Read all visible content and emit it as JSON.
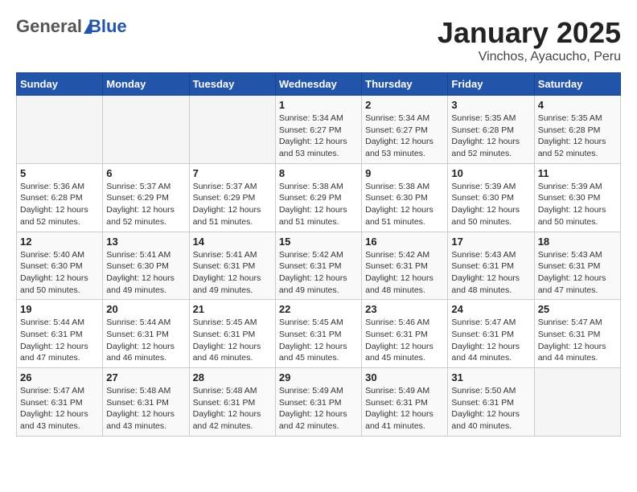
{
  "header": {
    "logo_general": "General",
    "logo_blue": "Blue",
    "title": "January 2025",
    "subtitle": "Vinchos, Ayacucho, Peru"
  },
  "days_of_week": [
    "Sunday",
    "Monday",
    "Tuesday",
    "Wednesday",
    "Thursday",
    "Friday",
    "Saturday"
  ],
  "weeks": [
    [
      {
        "day": "",
        "info": ""
      },
      {
        "day": "",
        "info": ""
      },
      {
        "day": "",
        "info": ""
      },
      {
        "day": "1",
        "info": "Sunrise: 5:34 AM\nSunset: 6:27 PM\nDaylight: 12 hours\nand 53 minutes."
      },
      {
        "day": "2",
        "info": "Sunrise: 5:34 AM\nSunset: 6:27 PM\nDaylight: 12 hours\nand 53 minutes."
      },
      {
        "day": "3",
        "info": "Sunrise: 5:35 AM\nSunset: 6:28 PM\nDaylight: 12 hours\nand 52 minutes."
      },
      {
        "day": "4",
        "info": "Sunrise: 5:35 AM\nSunset: 6:28 PM\nDaylight: 12 hours\nand 52 minutes."
      }
    ],
    [
      {
        "day": "5",
        "info": "Sunrise: 5:36 AM\nSunset: 6:28 PM\nDaylight: 12 hours\nand 52 minutes."
      },
      {
        "day": "6",
        "info": "Sunrise: 5:37 AM\nSunset: 6:29 PM\nDaylight: 12 hours\nand 52 minutes."
      },
      {
        "day": "7",
        "info": "Sunrise: 5:37 AM\nSunset: 6:29 PM\nDaylight: 12 hours\nand 51 minutes."
      },
      {
        "day": "8",
        "info": "Sunrise: 5:38 AM\nSunset: 6:29 PM\nDaylight: 12 hours\nand 51 minutes."
      },
      {
        "day": "9",
        "info": "Sunrise: 5:38 AM\nSunset: 6:30 PM\nDaylight: 12 hours\nand 51 minutes."
      },
      {
        "day": "10",
        "info": "Sunrise: 5:39 AM\nSunset: 6:30 PM\nDaylight: 12 hours\nand 50 minutes."
      },
      {
        "day": "11",
        "info": "Sunrise: 5:39 AM\nSunset: 6:30 PM\nDaylight: 12 hours\nand 50 minutes."
      }
    ],
    [
      {
        "day": "12",
        "info": "Sunrise: 5:40 AM\nSunset: 6:30 PM\nDaylight: 12 hours\nand 50 minutes."
      },
      {
        "day": "13",
        "info": "Sunrise: 5:41 AM\nSunset: 6:30 PM\nDaylight: 12 hours\nand 49 minutes."
      },
      {
        "day": "14",
        "info": "Sunrise: 5:41 AM\nSunset: 6:31 PM\nDaylight: 12 hours\nand 49 minutes."
      },
      {
        "day": "15",
        "info": "Sunrise: 5:42 AM\nSunset: 6:31 PM\nDaylight: 12 hours\nand 49 minutes."
      },
      {
        "day": "16",
        "info": "Sunrise: 5:42 AM\nSunset: 6:31 PM\nDaylight: 12 hours\nand 48 minutes."
      },
      {
        "day": "17",
        "info": "Sunrise: 5:43 AM\nSunset: 6:31 PM\nDaylight: 12 hours\nand 48 minutes."
      },
      {
        "day": "18",
        "info": "Sunrise: 5:43 AM\nSunset: 6:31 PM\nDaylight: 12 hours\nand 47 minutes."
      }
    ],
    [
      {
        "day": "19",
        "info": "Sunrise: 5:44 AM\nSunset: 6:31 PM\nDaylight: 12 hours\nand 47 minutes."
      },
      {
        "day": "20",
        "info": "Sunrise: 5:44 AM\nSunset: 6:31 PM\nDaylight: 12 hours\nand 46 minutes."
      },
      {
        "day": "21",
        "info": "Sunrise: 5:45 AM\nSunset: 6:31 PM\nDaylight: 12 hours\nand 46 minutes."
      },
      {
        "day": "22",
        "info": "Sunrise: 5:45 AM\nSunset: 6:31 PM\nDaylight: 12 hours\nand 45 minutes."
      },
      {
        "day": "23",
        "info": "Sunrise: 5:46 AM\nSunset: 6:31 PM\nDaylight: 12 hours\nand 45 minutes."
      },
      {
        "day": "24",
        "info": "Sunrise: 5:47 AM\nSunset: 6:31 PM\nDaylight: 12 hours\nand 44 minutes."
      },
      {
        "day": "25",
        "info": "Sunrise: 5:47 AM\nSunset: 6:31 PM\nDaylight: 12 hours\nand 44 minutes."
      }
    ],
    [
      {
        "day": "26",
        "info": "Sunrise: 5:47 AM\nSunset: 6:31 PM\nDaylight: 12 hours\nand 43 minutes."
      },
      {
        "day": "27",
        "info": "Sunrise: 5:48 AM\nSunset: 6:31 PM\nDaylight: 12 hours\nand 43 minutes."
      },
      {
        "day": "28",
        "info": "Sunrise: 5:48 AM\nSunset: 6:31 PM\nDaylight: 12 hours\nand 42 minutes."
      },
      {
        "day": "29",
        "info": "Sunrise: 5:49 AM\nSunset: 6:31 PM\nDaylight: 12 hours\nand 42 minutes."
      },
      {
        "day": "30",
        "info": "Sunrise: 5:49 AM\nSunset: 6:31 PM\nDaylight: 12 hours\nand 41 minutes."
      },
      {
        "day": "31",
        "info": "Sunrise: 5:50 AM\nSunset: 6:31 PM\nDaylight: 12 hours\nand 40 minutes."
      },
      {
        "day": "",
        "info": ""
      }
    ]
  ]
}
